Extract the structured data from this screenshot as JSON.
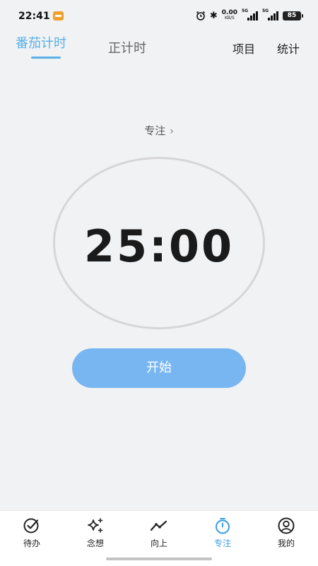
{
  "status_bar": {
    "time": "22:41",
    "net_speed_value": "0.00",
    "net_speed_unit": "KB/S",
    "signal1_label": "5G",
    "signal2_label": "5G",
    "battery": "85"
  },
  "top_tabs": {
    "pomodoro": "番茄计时",
    "timer": "正计时",
    "project": "项目",
    "stats": "统计"
  },
  "focus": {
    "label": "专注",
    "chevron": "›"
  },
  "timer": {
    "display": "25:00"
  },
  "start_button": "开始",
  "bottom_nav": {
    "items": [
      {
        "label": "待办",
        "icon": "check-circle-icon"
      },
      {
        "label": "念想",
        "icon": "sparkle-icon"
      },
      {
        "label": "向上",
        "icon": "trend-icon"
      },
      {
        "label": "专注",
        "icon": "stopwatch-icon"
      },
      {
        "label": "我的",
        "icon": "user-circle-icon"
      }
    ],
    "active_index": 3
  },
  "colors": {
    "accent": "#5ab0e8",
    "start_button": "#78b6f2",
    "nav_active": "#3a9ee4",
    "background": "#f1f2f4"
  }
}
